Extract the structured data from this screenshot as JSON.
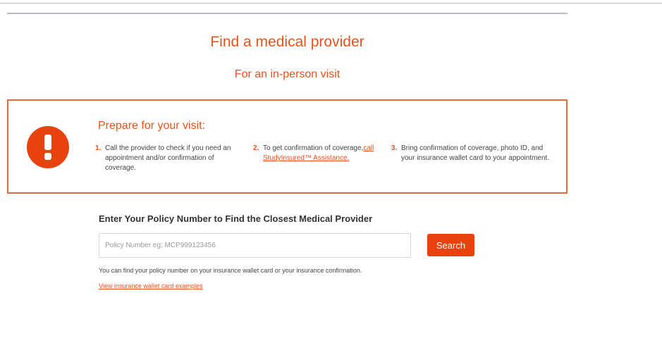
{
  "page": {
    "title": "Find a medical provider",
    "subtitle": "For an in-person visit"
  },
  "notice": {
    "icon": "exclamation-icon",
    "heading": "Prepare for your visit:",
    "steps": [
      {
        "number": "1.",
        "text": "Call the provider to check if you need an appointment and/or confirmation of coverage."
      },
      {
        "number": "2.",
        "text": "To get confirmation of coverage,",
        "link_text": "call StudyInsured™ Assistance."
      },
      {
        "number": "3.",
        "text": "Bring confirmation of coverage, photo ID, and your insurance wallet card to your appointment."
      }
    ]
  },
  "policy": {
    "heading": "Enter Your Policy Number to Find the Closest Medical Provider",
    "input_value": "",
    "input_placeholder": "Policy Number eg: MCP999123456",
    "search_label": "Search",
    "help_text": "You can find your policy number on your insurance wallet card or your insurance confirmation.",
    "examples_link": "View insurance wallet card examples"
  },
  "colors": {
    "accent": "#e8531c",
    "button": "#e8420f",
    "box_border": "#e86a3a"
  }
}
